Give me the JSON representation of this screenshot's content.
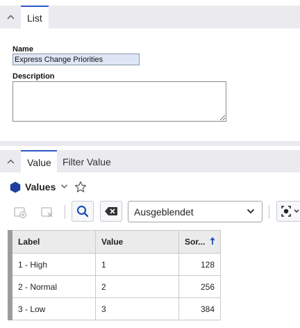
{
  "list_section": {
    "tab_label": "List",
    "name_label": "Name",
    "name_value": "Express Change Priorities",
    "description_label": "Description",
    "description_value": ""
  },
  "value_section": {
    "tabs": [
      {
        "label": "Value",
        "active": true
      },
      {
        "label": "Filter Value",
        "active": false
      }
    ],
    "title": "Values",
    "filter_select": "Ausgeblendet",
    "icons": {
      "title": "hexagon-icon",
      "title_menu": "chevron-down-icon",
      "favorite": "star-icon",
      "new": "add-record-icon",
      "delete": "delete-record-icon",
      "search": "search-icon",
      "clear": "clear-filter-icon",
      "view": "view-settings-icon"
    },
    "grid": {
      "columns": [
        "Label",
        "Value",
        "Sor..."
      ],
      "sorted_column": 2,
      "rows": [
        {
          "label": "1 - High",
          "value": "1",
          "sort": "128"
        },
        {
          "label": "2 - Normal",
          "value": "2",
          "sort": "256"
        },
        {
          "label": "3 - Low",
          "value": "3",
          "sort": "384"
        }
      ]
    }
  },
  "colors": {
    "accent": "#2b57c7",
    "tabbar": "#ebebef",
    "background": "#e9e9ee",
    "icon_blue": "#2b57c7",
    "title_icon": "#1f3f9e"
  }
}
